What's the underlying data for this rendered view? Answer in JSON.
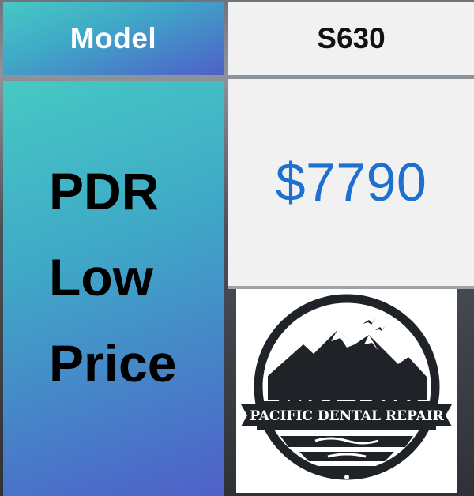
{
  "table": {
    "model_label": "Model",
    "model_value": "S630",
    "promo_lines": [
      "PDR",
      "Low",
      "Price"
    ],
    "price": "$7790"
  },
  "logo": {
    "text": "PACIFIC DENTAL REPAIR",
    "icon": "mountain-elk-emblem-icon"
  },
  "colors": {
    "gradient_start": "#46c9c4",
    "gradient_end": "#5060c8",
    "price_blue": "#1d6fd0",
    "cell_light": "#f1f1f1",
    "logo_dark": "#1f2328"
  }
}
